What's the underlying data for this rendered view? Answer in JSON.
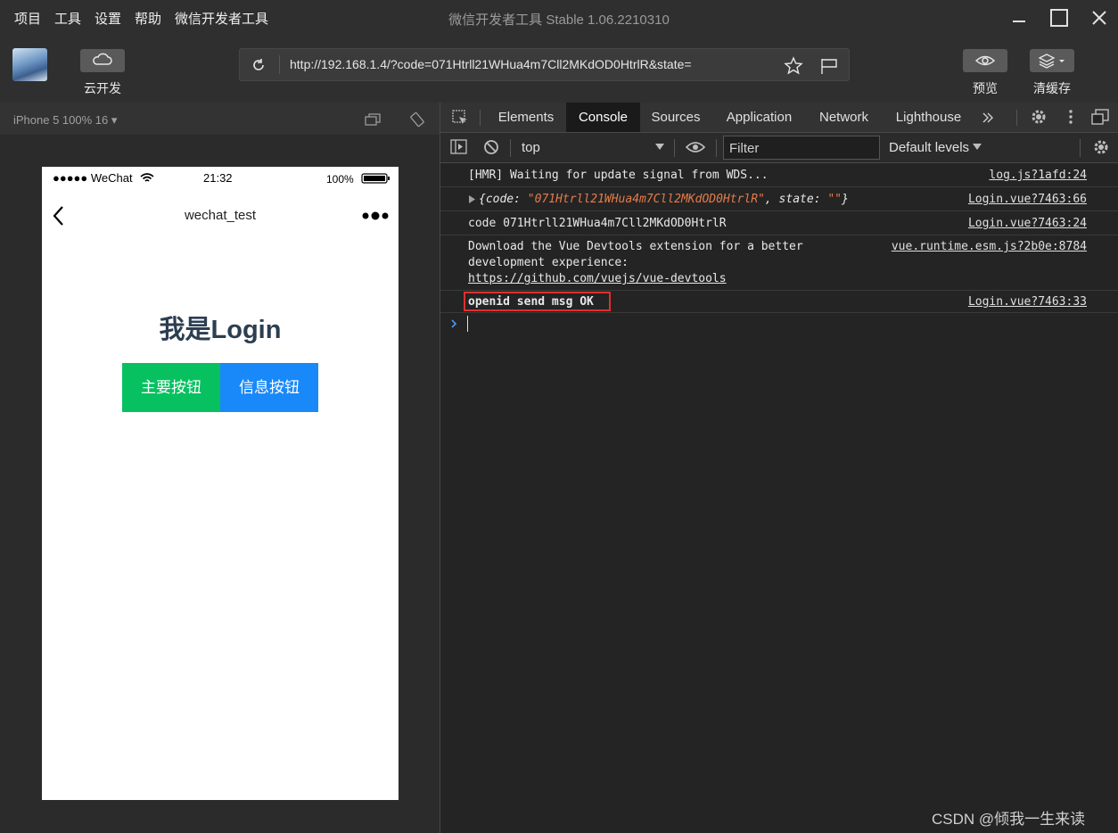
{
  "menubar": {
    "items": [
      "项目",
      "工具",
      "设置",
      "帮助",
      "微信开发者工具"
    ],
    "title": "微信开发者工具 Stable 1.06.2210310"
  },
  "toolbar": {
    "cloud_label": "云开发",
    "url": "http://192.168.1.4/?code=071Htrll21WHua4m7Cll2MKdOD0HtrlR&state=",
    "preview_label": "预览",
    "clear_cache_label": "清缓存"
  },
  "simulator": {
    "device_label": "iPhone 5 100% 16 ▾",
    "status": {
      "carrier": "●●●●● WeChat",
      "time": "21:32",
      "battery": "100%"
    },
    "nav_title": "wechat_test",
    "heading": "我是Login",
    "primary_button": "主要按钮",
    "info_button": "信息按钮",
    "colors": {
      "primary": "#07c160",
      "info": "#1989fa"
    }
  },
  "devtools": {
    "tabs": [
      "Elements",
      "Console",
      "Sources",
      "Application",
      "Network",
      "Lighthouse"
    ],
    "active_tab": "Console",
    "context": "top",
    "filter_placeholder": "Filter",
    "levels": "Default levels",
    "console": [
      {
        "text": "[HMR] Waiting for update signal from WDS...",
        "source": "log.js?1afd:24"
      },
      {
        "obj_prefix": "{code: ",
        "obj_code": "\"071Htrll21WHua4m7Cll2MKdOD0HtrlR\"",
        "obj_mid": ", state: ",
        "obj_state": "\"\"",
        "obj_suffix": "}",
        "source": "Login.vue?7463:66"
      },
      {
        "text": "code 071Htrll21WHua4m7Cll2MKdOD0HtrlR",
        "source": "Login.vue?7463:24"
      },
      {
        "line1": "Download the Vue Devtools extension for a better",
        "line2": "development experience:",
        "link": "https://github.com/vuejs/vue-devtools",
        "source": "vue.runtime.esm.js?2b0e:8784"
      },
      {
        "text": "openid send msg OK",
        "source": "Login.vue?7463:33",
        "highlight": "#e02f2f"
      }
    ]
  },
  "watermark": "CSDN @倾我一生来读"
}
